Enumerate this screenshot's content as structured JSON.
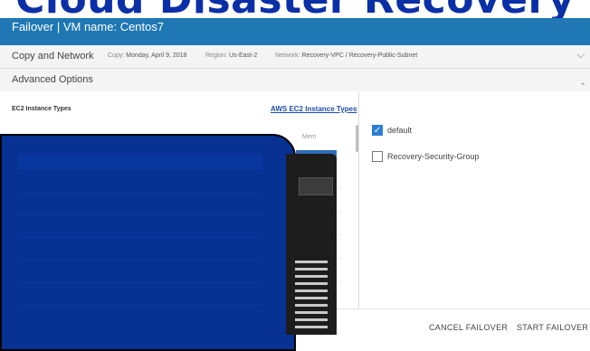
{
  "banner": {
    "title": "Cloud Disaster Recovery"
  },
  "header": {
    "title": "Failover | VM name: Centos7"
  },
  "copy_network": {
    "label": "Copy and Network",
    "copy_key": "Copy:",
    "copy_value": "Monday, April 9, 2018",
    "region_key": "Region:",
    "region_value": "Us-East-2",
    "network_key": "Network:",
    "network_value": "Recovery-VPC / Recovery-Public-Subnet",
    "chevron": "chevron-down-icon"
  },
  "advanced": {
    "label": "Advanced Options",
    "chevron": "chevron-up-icon"
  },
  "ec2": {
    "title": "EC2 Instance Types",
    "link": "AWS EC2 Instance Types",
    "column_mem": "Mem"
  },
  "security_groups": [
    {
      "label": "default",
      "checked": true
    },
    {
      "label": "Recovery-Security-Group",
      "checked": false
    }
  ],
  "footer": {
    "cancel": "CANCEL FAILOVER",
    "start": "START FAILOVER"
  },
  "colors": {
    "header": "#1f78b4",
    "banner_text": "#0b2fa7",
    "overlay": "#073192",
    "checkbox": "#2b7fd3"
  }
}
